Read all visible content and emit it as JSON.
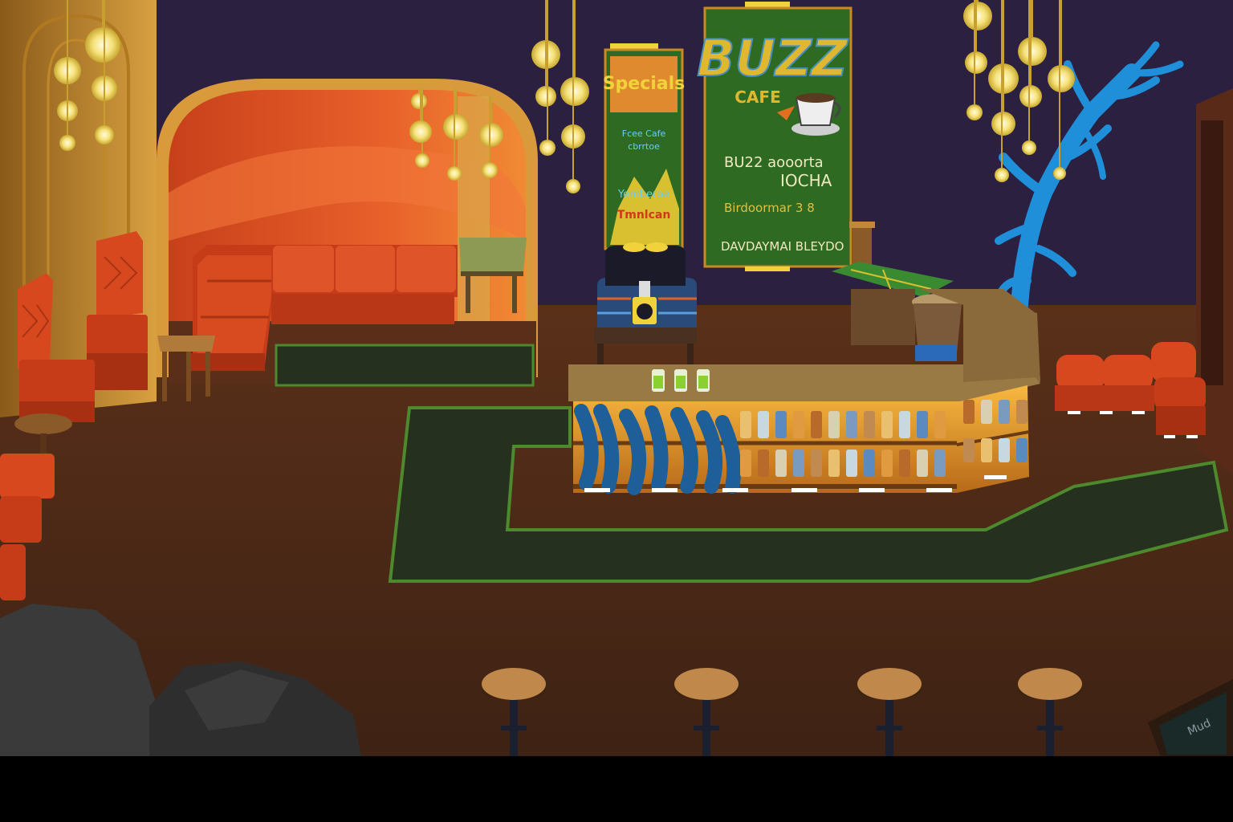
{
  "scene": {
    "name": "Buzz Cafe interior",
    "palette": {
      "wall": "#2b2040",
      "floor": "#4a2a1a",
      "rug": "#26301e",
      "rug_border": "#4d8a2e",
      "couch": "#d8481e",
      "sign_green": "#2f6a22",
      "coral": "#1e8fd8",
      "bar_light": "#f0a030",
      "lamp": "#fff3a0"
    }
  },
  "main_sign": {
    "title": "BUZZ",
    "subtitle": "CAFE",
    "lines": [
      "BU22 aooorta",
      "IOCHA",
      "Birdoormar 3 8",
      "DAVDAYMAI BLEYDO"
    ]
  },
  "specials_sign": {
    "title": "Specials",
    "scribble": [
      "Fcee Cafe",
      "cbrrtoe"
    ],
    "bottom": [
      "Yemberoe",
      "Tmnlcan"
    ]
  },
  "menu_board_small": {
    "text": "Mud"
  },
  "counter": {
    "drinks": 3
  },
  "stools": {
    "count": 4
  }
}
